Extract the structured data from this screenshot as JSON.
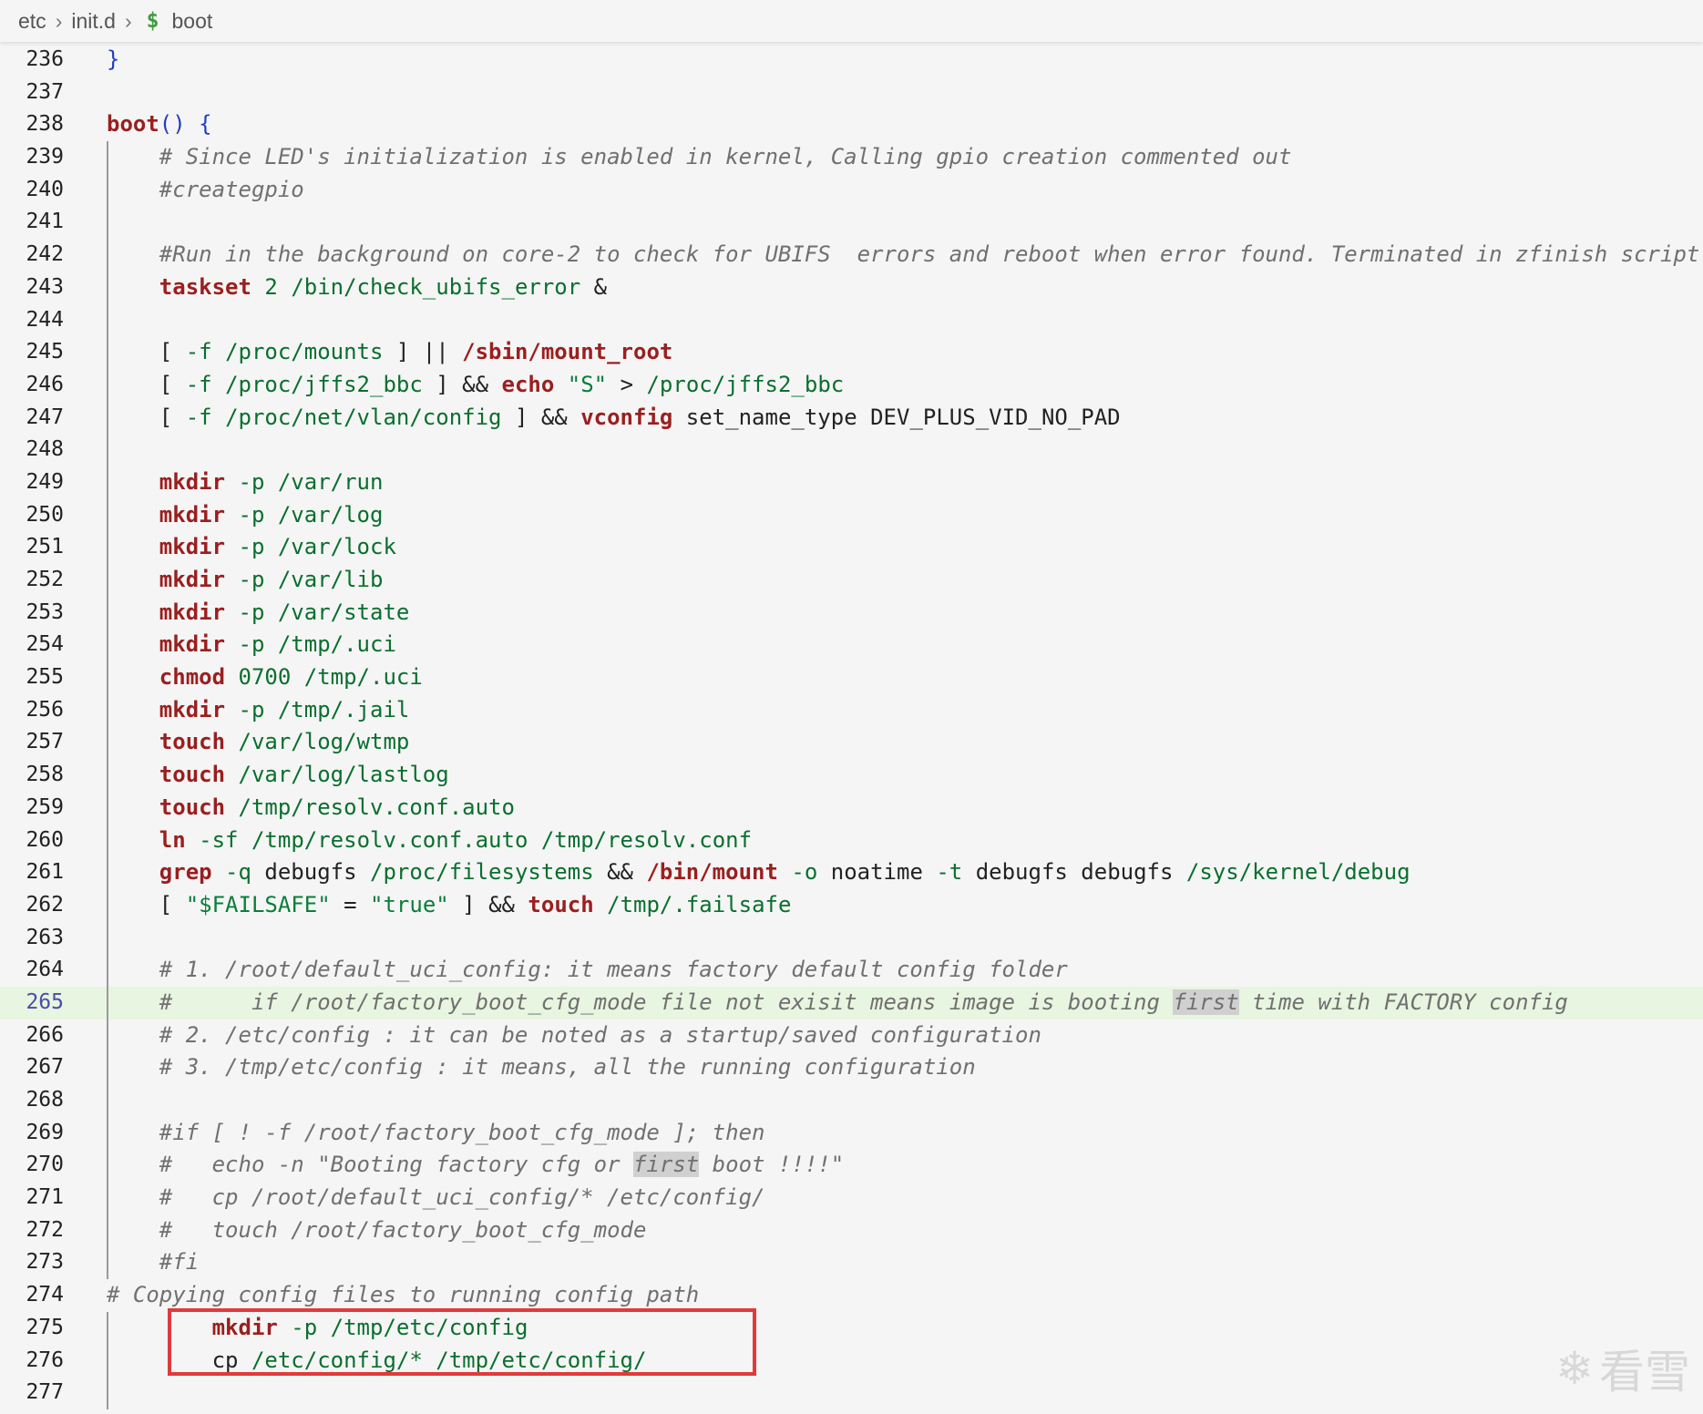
{
  "breadcrumb": {
    "items": [
      "etc",
      "init.d"
    ],
    "file_icon": "$",
    "file_name": "boot"
  },
  "editor": {
    "active_line": 265,
    "lines": [
      {
        "n": "236",
        "text": "}"
      },
      {
        "n": "237",
        "text": ""
      },
      {
        "n": "238",
        "text": "boot() {"
      },
      {
        "n": "239",
        "text": "    # Since LED's initialization is enabled in kernel, Calling gpio creation commented out"
      },
      {
        "n": "240",
        "text": "    #creategpio"
      },
      {
        "n": "241",
        "text": ""
      },
      {
        "n": "242",
        "text": "    #Run in the background on core-2 to check for UBIFS  errors and reboot when error found. Terminated in zfinish script."
      },
      {
        "n": "243",
        "text": "    taskset 2 /bin/check_ubifs_error &"
      },
      {
        "n": "244",
        "text": ""
      },
      {
        "n": "245",
        "text": "    [ -f /proc/mounts ] || /sbin/mount_root"
      },
      {
        "n": "246",
        "text": "    [ -f /proc/jffs2_bbc ] && echo \"S\" > /proc/jffs2_bbc"
      },
      {
        "n": "247",
        "text": "    [ -f /proc/net/vlan/config ] && vconfig set_name_type DEV_PLUS_VID_NO_PAD"
      },
      {
        "n": "248",
        "text": ""
      },
      {
        "n": "249",
        "text": "    mkdir -p /var/run"
      },
      {
        "n": "250",
        "text": "    mkdir -p /var/log"
      },
      {
        "n": "251",
        "text": "    mkdir -p /var/lock"
      },
      {
        "n": "252",
        "text": "    mkdir -p /var/lib"
      },
      {
        "n": "253",
        "text": "    mkdir -p /var/state"
      },
      {
        "n": "254",
        "text": "    mkdir -p /tmp/.uci"
      },
      {
        "n": "255",
        "text": "    chmod 0700 /tmp/.uci"
      },
      {
        "n": "256",
        "text": "    mkdir -p /tmp/.jail"
      },
      {
        "n": "257",
        "text": "    touch /var/log/wtmp"
      },
      {
        "n": "258",
        "text": "    touch /var/log/lastlog"
      },
      {
        "n": "259",
        "text": "    touch /tmp/resolv.conf.auto"
      },
      {
        "n": "260",
        "text": "    ln -sf /tmp/resolv.conf.auto /tmp/resolv.conf"
      },
      {
        "n": "261",
        "text": "    grep -q debugfs /proc/filesystems && /bin/mount -o noatime -t debugfs debugfs /sys/kernel/debug"
      },
      {
        "n": "262",
        "text": "    [ \"$FAILSAFE\" = \"true\" ] && touch /tmp/.failsafe"
      },
      {
        "n": "263",
        "text": ""
      },
      {
        "n": "264",
        "text": "    # 1. /root/default_uci_config: it means factory default config folder"
      },
      {
        "n": "265",
        "text": "    #      if /root/factory_boot_cfg_mode file not exisit means image is booting first time with FACTORY config"
      },
      {
        "n": "266",
        "text": "    # 2. /etc/config : it can be noted as a startup/saved configuration"
      },
      {
        "n": "267",
        "text": "    # 3. /tmp/etc/config : it means, all the running configuration"
      },
      {
        "n": "268",
        "text": ""
      },
      {
        "n": "269",
        "text": "    #if [ ! -f /root/factory_boot_cfg_mode ]; then"
      },
      {
        "n": "270",
        "text": "    #   echo -n \"Booting factory cfg or first boot !!!!\""
      },
      {
        "n": "271",
        "text": "    #   cp /root/default_uci_config/* /etc/config/"
      },
      {
        "n": "272",
        "text": "    #   touch /root/factory_boot_cfg_mode"
      },
      {
        "n": "273",
        "text": "    #fi"
      },
      {
        "n": "274",
        "text": "# Copying config files to running config path"
      },
      {
        "n": "275",
        "text": "        mkdir -p /tmp/etc/config"
      },
      {
        "n": "276",
        "text": "        cp /etc/config/* /tmp/etc/config/"
      },
      {
        "n": "277",
        "text": ""
      }
    ]
  },
  "annotation": {
    "highlight_color": "#e23a3a"
  },
  "watermark": {
    "icon": "snowflake-icon",
    "text": "看雪"
  }
}
